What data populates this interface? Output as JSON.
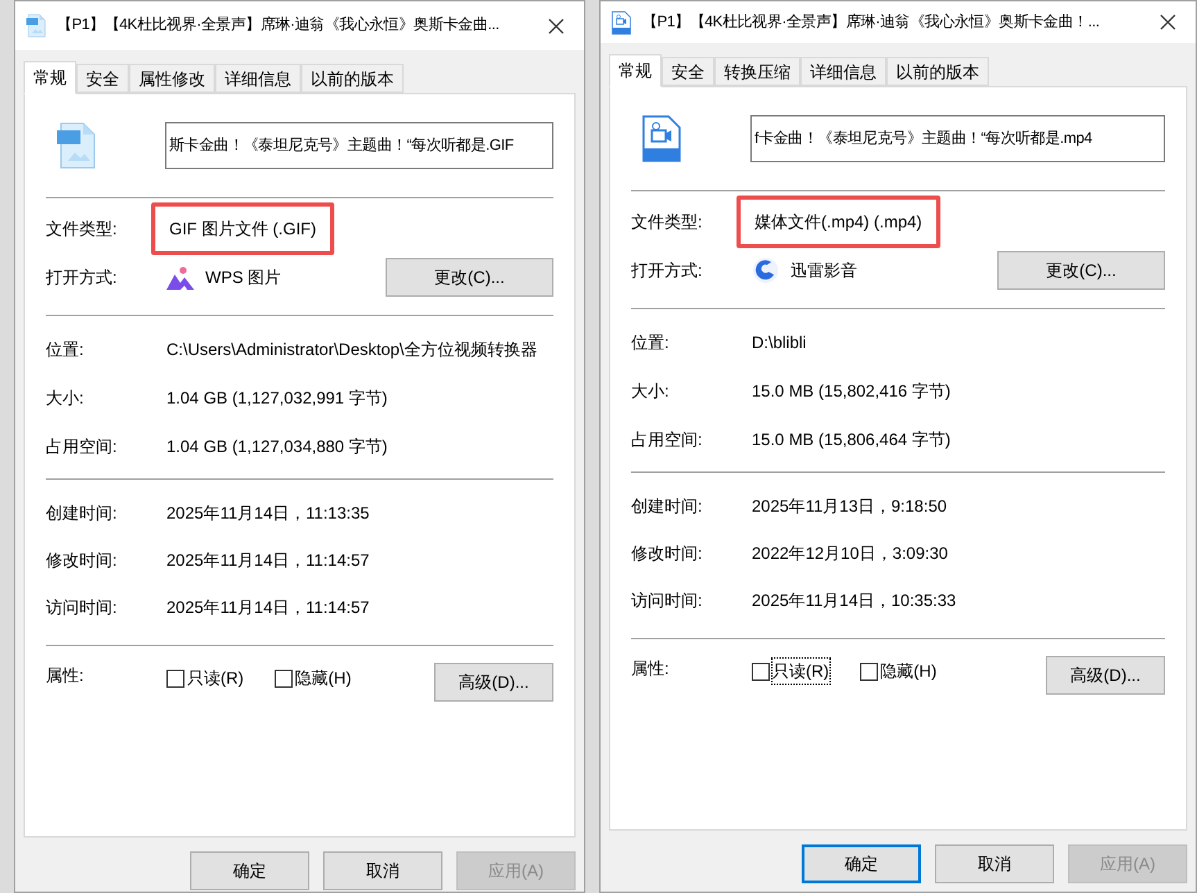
{
  "windows": [
    {
      "kind": "gif",
      "title": "【P1】【4K杜比视界·全景声】席琳·迪翁《我心永恒》奥斯卡金曲...",
      "tabs": [
        {
          "label": "常规",
          "selected": true
        },
        {
          "label": "安全",
          "selected": false
        },
        {
          "label": "属性修改",
          "selected": false
        },
        {
          "label": "详细信息",
          "selected": false
        },
        {
          "label": "以前的版本",
          "selected": false
        }
      ],
      "file_name": "斯卡金曲！《泰坦尼克号》主题曲！“每次听都是.GIF",
      "file_type": {
        "label": "文件类型:",
        "value": "GIF 图片文件 (.GIF)",
        "highlighted": true
      },
      "open_with": {
        "label": "打开方式:",
        "app": "WPS 图片",
        "kind": "wps",
        "button": "更改(C)..."
      },
      "info": [
        {
          "label": "位置:",
          "value": "C:\\Users\\Administrator\\Desktop\\全方位视频转换器"
        },
        {
          "label": "大小:",
          "value": "1.04 GB (1,127,032,991 字节)"
        },
        {
          "label": "占用空间:",
          "value": "1.04 GB (1,127,034,880 字节)"
        }
      ],
      "times": [
        {
          "label": "创建时间:",
          "value": "2025年11月14日，11:13:35"
        },
        {
          "label": "修改时间:",
          "value": "2025年11月14日，11:14:57"
        },
        {
          "label": "访问时间:",
          "value": "2025年11月14日，11:14:57"
        }
      ],
      "attributes": {
        "label": "属性:",
        "checkboxes": [
          {
            "label": "只读(R)",
            "checked": false,
            "focused": false
          },
          {
            "label": "隐藏(H)",
            "checked": false,
            "focused": false
          }
        ],
        "button": "高级(D)..."
      },
      "buttons": [
        {
          "label": "确定",
          "disabled": false,
          "focused": false
        },
        {
          "label": "取消",
          "disabled": false,
          "focused": false
        },
        {
          "label": "应用(A)",
          "disabled": true,
          "focused": false
        }
      ]
    },
    {
      "kind": "mp4",
      "title": "【P1】【4K杜比视界·全景声】席琳·迪翁《我心永恒》奥斯卡金曲！...",
      "tabs": [
        {
          "label": "常规",
          "selected": true
        },
        {
          "label": "安全",
          "selected": false
        },
        {
          "label": "转换压缩",
          "selected": false
        },
        {
          "label": "详细信息",
          "selected": false
        },
        {
          "label": "以前的版本",
          "selected": false
        }
      ],
      "file_name": "f卡金曲！《泰坦尼克号》主题曲！“每次听都是.mp4",
      "file_type": {
        "label": "文件类型:",
        "value": "媒体文件(.mp4) (.mp4)",
        "highlighted": true
      },
      "open_with": {
        "label": "打开方式:",
        "app": "迅雷影音",
        "kind": "xunlei",
        "button": "更改(C)..."
      },
      "info": [
        {
          "label": "位置:",
          "value": "D:\\blibli"
        },
        {
          "label": "大小:",
          "value": "15.0 MB (15,802,416 字节)"
        },
        {
          "label": "占用空间:",
          "value": "15.0 MB (15,806,464 字节)"
        }
      ],
      "times": [
        {
          "label": "创建时间:",
          "value": "2025年11月13日，9:18:50"
        },
        {
          "label": "修改时间:",
          "value": "2022年12月10日，3:09:30"
        },
        {
          "label": "访问时间:",
          "value": "2025年11月14日，10:35:33"
        }
      ],
      "attributes": {
        "label": "属性:",
        "checkboxes": [
          {
            "label": "只读(R)",
            "checked": false,
            "focused": true
          },
          {
            "label": "隐藏(H)",
            "checked": false,
            "focused": false
          }
        ],
        "button": "高级(D)..."
      },
      "buttons": [
        {
          "label": "确定",
          "disabled": false,
          "focused": true
        },
        {
          "label": "取消",
          "disabled": false,
          "focused": false
        },
        {
          "label": "应用(A)",
          "disabled": true,
          "focused": false
        }
      ]
    }
  ]
}
